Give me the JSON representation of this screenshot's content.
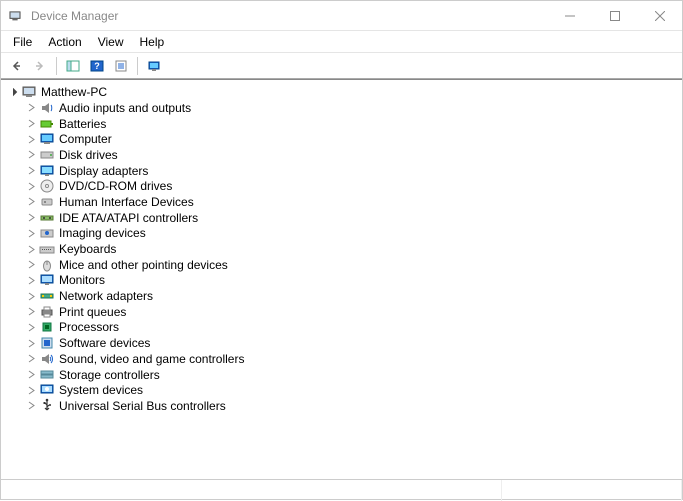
{
  "window": {
    "title": "Device Manager"
  },
  "menu": {
    "items": [
      "File",
      "Action",
      "View",
      "Help"
    ]
  },
  "toolbar": {
    "back": "back-arrow",
    "forward": "forward-arrow",
    "show_hide": "show-hide-console-tree",
    "help": "help",
    "action": "action",
    "scan": "scan-hardware"
  },
  "tree": {
    "root": {
      "label": "Matthew-PC",
      "icon": "computer-root-icon",
      "expanded": true
    },
    "children": [
      {
        "label": "Audio inputs and outputs",
        "icon": "audio-icon"
      },
      {
        "label": "Batteries",
        "icon": "battery-icon"
      },
      {
        "label": "Computer",
        "icon": "computer-icon"
      },
      {
        "label": "Disk drives",
        "icon": "disk-icon"
      },
      {
        "label": "Display adapters",
        "icon": "display-icon"
      },
      {
        "label": "DVD/CD-ROM drives",
        "icon": "dvd-icon"
      },
      {
        "label": "Human Interface Devices",
        "icon": "hid-icon"
      },
      {
        "label": "IDE ATA/ATAPI controllers",
        "icon": "ide-icon"
      },
      {
        "label": "Imaging devices",
        "icon": "imaging-icon"
      },
      {
        "label": "Keyboards",
        "icon": "keyboard-icon"
      },
      {
        "label": "Mice and other pointing devices",
        "icon": "mouse-icon"
      },
      {
        "label": "Monitors",
        "icon": "monitor-icon"
      },
      {
        "label": "Network adapters",
        "icon": "network-icon"
      },
      {
        "label": "Print queues",
        "icon": "printer-icon"
      },
      {
        "label": "Processors",
        "icon": "processor-icon"
      },
      {
        "label": "Software devices",
        "icon": "software-icon"
      },
      {
        "label": "Sound, video and game controllers",
        "icon": "sound-icon"
      },
      {
        "label": "Storage controllers",
        "icon": "storage-icon"
      },
      {
        "label": "System devices",
        "icon": "system-icon"
      },
      {
        "label": "Universal Serial Bus controllers",
        "icon": "usb-icon"
      }
    ]
  }
}
